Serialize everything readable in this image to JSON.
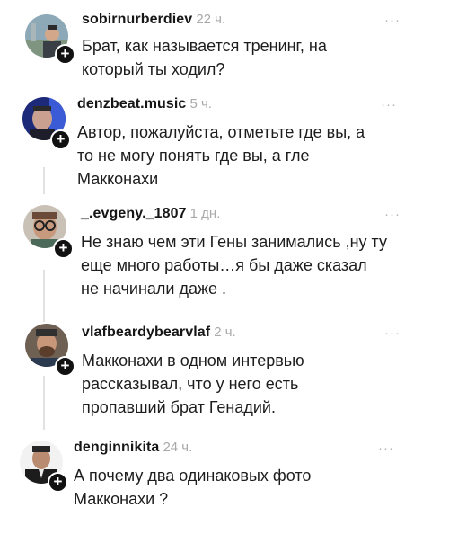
{
  "comments": [
    {
      "username": "sobirnurberdiev",
      "time": "22 ч.",
      "text": "Брат, как называется тренинг, на\nкоторый ты ходил?",
      "avatar": "avatar-photo-outdoor"
    },
    {
      "username": "denzbeat.music",
      "time": "5 ч.",
      "text": "Автор, пожалуйста, отметьте где вы, а\nто не могу понять где вы, а гле\nМакконахи",
      "avatar": "avatar-photo-blue-light"
    },
    {
      "username": "_.evgeny._1807",
      "time": "1 дн.",
      "text": "Не знаю чем эти Гены занимались ,ну ту\nеще много работы…я бы даже сказал\nне начинали даже .",
      "avatar": "avatar-photo-glasses"
    },
    {
      "username": "vlafbeardybearvlaf",
      "time": "2 ч.",
      "text": "Макконахи в одном интервью\nрассказывал, что у него есть\nпропавший брат Генадий.",
      "avatar": "avatar-photo-beard-cap"
    },
    {
      "username": "denginnikita",
      "time": "24 ч.",
      "text": "А почему два одинаковых фото\nМакконахи ?",
      "avatar": "avatar-photo-suit"
    }
  ],
  "ui": {
    "more_glyph": "···",
    "follow_glyph": "+"
  },
  "colors": {
    "username": "#161616",
    "timestamp": "#a9a9a9",
    "body_text": "#1d1d1d",
    "follow_badge": "#111111",
    "thread_line": "#e2e2e2"
  }
}
